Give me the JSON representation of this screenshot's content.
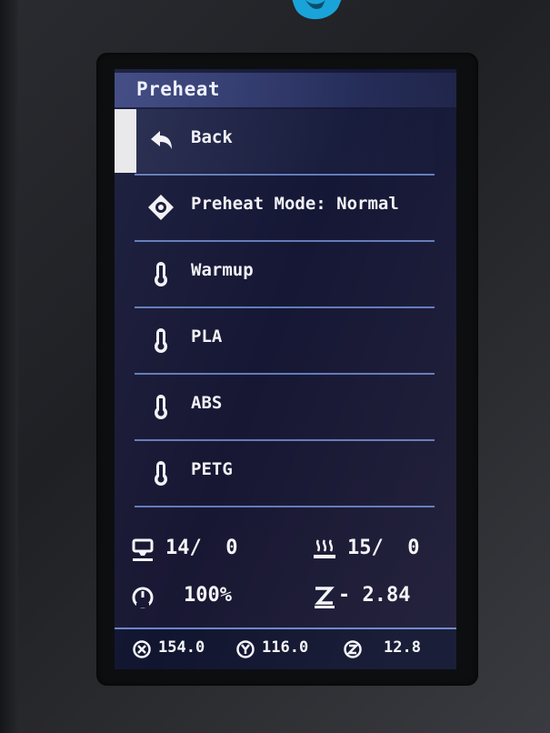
{
  "screen": {
    "title": "Preheat"
  },
  "menu": {
    "items": [
      {
        "label": "Back",
        "icon": "back-arrow-icon"
      },
      {
        "label": "Preheat Mode: Normal",
        "icon": "target-diamond-icon"
      },
      {
        "label": "Warmup",
        "icon": "thermometer-icon"
      },
      {
        "label": "PLA",
        "icon": "thermometer-icon"
      },
      {
        "label": "ABS",
        "icon": "thermometer-icon"
      },
      {
        "label": "PETG",
        "icon": "thermometer-icon"
      }
    ],
    "selected_index": 0
  },
  "status": {
    "hotend": "14/  0",
    "bed": "15/  0",
    "speed": "100%",
    "z_offset": "- 2.84"
  },
  "footer": {
    "x": "154.0",
    "y": "116.0",
    "z": "12.8"
  },
  "colors": {
    "accent": "#6a86c8",
    "title_bar": "#3b4680",
    "screen_bg": "#151735",
    "text": "#f2f2f6",
    "brand_logo": "#1aa3d9"
  }
}
